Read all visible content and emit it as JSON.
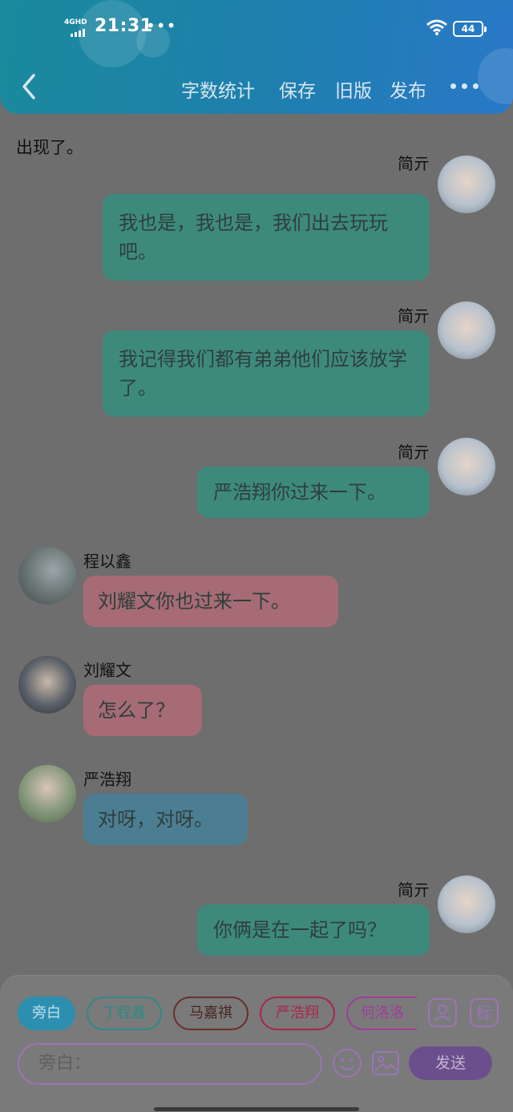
{
  "status_bar": {
    "network": "4GHD",
    "time": "21:31",
    "more_dots": "•••",
    "battery": "44"
  },
  "header": {
    "actions": [
      {
        "label": "字数统计"
      },
      {
        "label": "保存"
      },
      {
        "label": "旧版"
      },
      {
        "label": "发布"
      }
    ]
  },
  "chat": {
    "narration": "出现了。",
    "messages": [
      {
        "sender": "简亓",
        "side": "right",
        "text": "我也是，我也是，我们出去玩玩吧。",
        "color": "#3d8a7d"
      },
      {
        "sender": "简亓",
        "side": "right",
        "text": "我记得我们都有弟弟他们应该放学了。",
        "color": "#3d8a7d"
      },
      {
        "sender": "简亓",
        "side": "right",
        "text": "严浩翔你过来一下。",
        "color": "#3d8a7d"
      },
      {
        "sender": "程以鑫",
        "side": "left",
        "text": "刘耀文你也过来一下。",
        "color": "#a66b74"
      },
      {
        "sender": "刘耀文",
        "side": "left",
        "text": "怎么了？",
        "color": "#a66b74"
      },
      {
        "sender": "严浩翔",
        "side": "left",
        "text": "对呀，对呀。",
        "color": "#4c7e93"
      },
      {
        "sender": "简亓",
        "side": "right",
        "text": "你俩是在一起了吗？",
        "color": "#3d8a7d"
      }
    ]
  },
  "composer": {
    "characters": [
      {
        "label": "旁白",
        "color": "#2c8fb0"
      },
      {
        "label": "丁程鑫",
        "color": "#2e8a86"
      },
      {
        "label": "马嘉祺",
        "color": "#6b2f2a"
      },
      {
        "label": "严浩翔",
        "color": "#a6284a"
      },
      {
        "label": "何洛洛",
        "color": "#a03c9a"
      }
    ],
    "tag_button": "标",
    "input_placeholder": "旁白：",
    "send_label": "发送",
    "accent_color": "#9a74b8"
  }
}
